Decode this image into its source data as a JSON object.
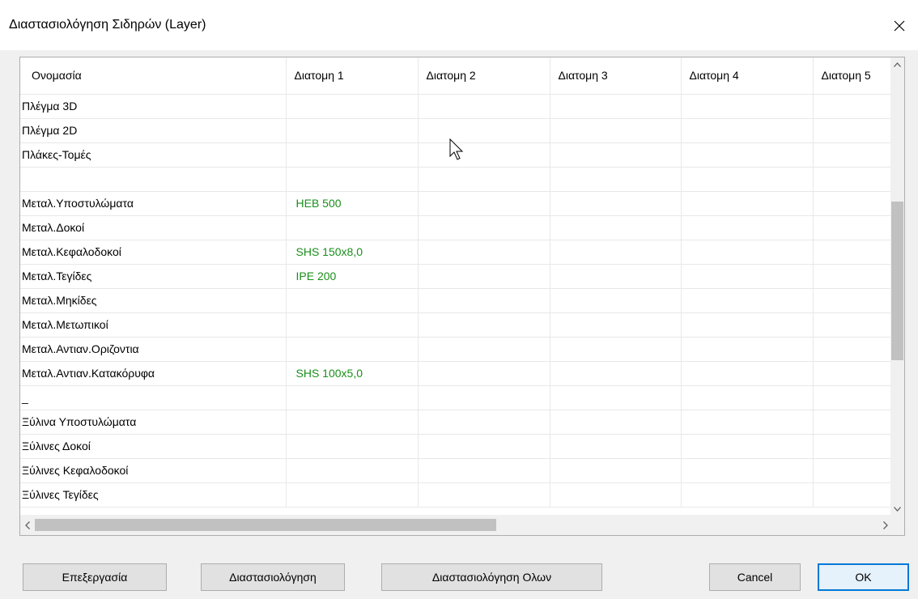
{
  "window": {
    "title": "Διαστασιολόγηση Σιδηρών (Layer)",
    "close_glyph": "✕"
  },
  "grid": {
    "columns": [
      "Ονομασία",
      "Διατομη 1",
      "Διατομη 2",
      "Διατομη 3",
      "Διατομη 4",
      "Διατομη 5"
    ],
    "rows": [
      {
        "name": "Πλέγμα 3D",
        "values": [
          "",
          "",
          "",
          "",
          ""
        ]
      },
      {
        "name": "Πλέγμα 2D",
        "values": [
          "",
          "",
          "",
          "",
          ""
        ]
      },
      {
        "name": "Πλάκες-Τομές",
        "values": [
          "",
          "",
          "",
          "",
          ""
        ]
      },
      {
        "name": "",
        "values": [
          "",
          "",
          "",
          "",
          ""
        ]
      },
      {
        "name": "Μεταλ.Υποστυλώματα",
        "values": [
          "HEB 500",
          "",
          "",
          "",
          ""
        ]
      },
      {
        "name": "Μεταλ.Δοκοί",
        "values": [
          "",
          "",
          "",
          "",
          ""
        ]
      },
      {
        "name": "Μεταλ.Κεφαλοδοκοί",
        "values": [
          "SHS 150x8,0",
          "",
          "",
          "",
          ""
        ]
      },
      {
        "name": "Μεταλ.Τεγίδες",
        "values": [
          "IPE 200",
          "",
          "",
          "",
          ""
        ]
      },
      {
        "name": "Μεταλ.Μηκίδες",
        "values": [
          "",
          "",
          "",
          "",
          ""
        ]
      },
      {
        "name": "Μεταλ.Μετωπικοί",
        "values": [
          "",
          "",
          "",
          "",
          ""
        ]
      },
      {
        "name": "Μεταλ.Αντιαν.Οριζοντια",
        "values": [
          "",
          "",
          "",
          "",
          ""
        ]
      },
      {
        "name": "Μεταλ.Αντιαν.Κατακόρυφα",
        "values": [
          "SHS 100x5,0",
          "",
          "",
          "",
          ""
        ]
      },
      {
        "name": "_",
        "values": [
          "",
          "",
          "",
          "",
          ""
        ]
      },
      {
        "name": "Ξύλινα Υποστυλώματα",
        "values": [
          "",
          "",
          "",
          "",
          ""
        ]
      },
      {
        "name": "Ξύλινες Δοκοί",
        "values": [
          "",
          "",
          "",
          "",
          ""
        ]
      },
      {
        "name": "Ξύλινες Κεφαλοδοκοί",
        "values": [
          "",
          "",
          "",
          "",
          ""
        ]
      },
      {
        "name": "Ξύλινες Τεγίδες",
        "values": [
          "",
          "",
          "",
          "",
          ""
        ]
      }
    ]
  },
  "buttons": {
    "edit": "Επεξεργασία",
    "size": "Διαστασιολόγηση",
    "size_all": "Διαστασιολόγηση Ολων",
    "cancel": "Cancel",
    "ok": "OK"
  },
  "colors": {
    "value_text": "#1a8f1a",
    "ok_border": "#0078d7"
  }
}
